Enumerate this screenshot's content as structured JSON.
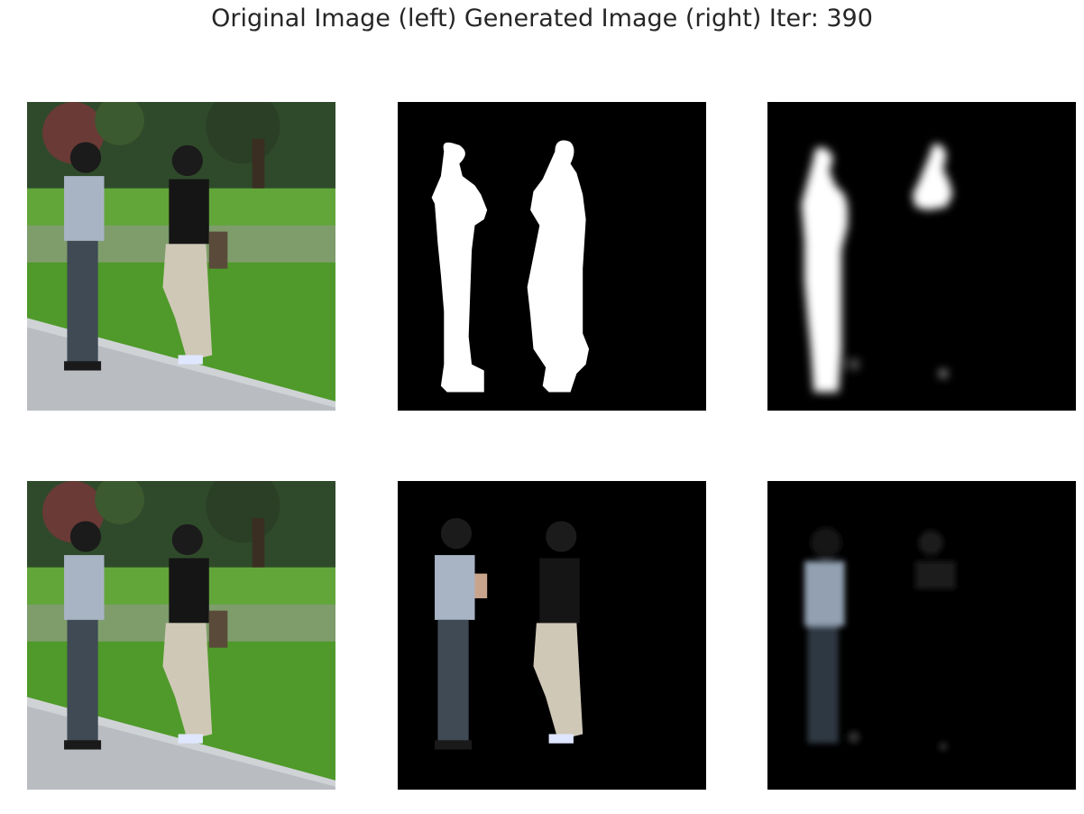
{
  "figure": {
    "title": "Original Image (left) Generated Image (right) Iter: 390"
  },
  "panels": [
    {
      "row": 1,
      "col": 1,
      "content": "original photo"
    },
    {
      "row": 1,
      "col": 2,
      "content": "binary mask"
    },
    {
      "row": 1,
      "col": 3,
      "content": "generated mask"
    },
    {
      "row": 2,
      "col": 1,
      "content": "original photo"
    },
    {
      "row": 2,
      "col": 2,
      "content": "masked original"
    },
    {
      "row": 2,
      "col": 3,
      "content": "generated masked image"
    }
  ],
  "colors": {
    "background": "#ffffff",
    "title_text": "#262626",
    "mask_bg": "#000000",
    "mask_fg": "#ffffff",
    "grass": "#4f9a2a",
    "trees": "#2f4a2a",
    "sidewalk": "#b9bcc1",
    "shirt_left": "#a8b4c4",
    "pants_left": "#3f4a55",
    "shirt_right": "#151515",
    "pants_right": "#cfc8b7"
  }
}
